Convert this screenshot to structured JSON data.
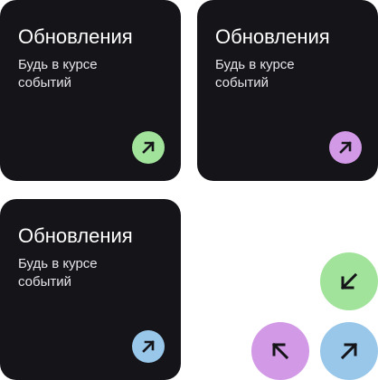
{
  "colors": {
    "card_bg": "#141419",
    "green": "#a1e39a",
    "purple": "#d29ae6",
    "blue": "#98c7ea",
    "arrow": "#141419"
  },
  "cards": [
    {
      "title": "Обновления",
      "subtitle": "Будь в курсе событий",
      "button_icon": "arrow-up-right-icon",
      "button_color": "#a1e39a"
    },
    {
      "title": "Обновления",
      "subtitle": "Будь в курсе событий",
      "button_icon": "arrow-up-right-icon",
      "button_color": "#d29ae6"
    },
    {
      "title": "Обновления",
      "subtitle": "Будь в курсе событий",
      "button_icon": "arrow-up-right-icon",
      "button_color": "#98c7ea"
    }
  ],
  "round_buttons": [
    {
      "icon": "arrow-down-left-icon",
      "color": "#a1e39a"
    },
    {
      "icon": "arrow-up-left-icon",
      "color": "#d29ae6"
    },
    {
      "icon": "arrow-up-right-icon",
      "color": "#98c7ea"
    }
  ]
}
